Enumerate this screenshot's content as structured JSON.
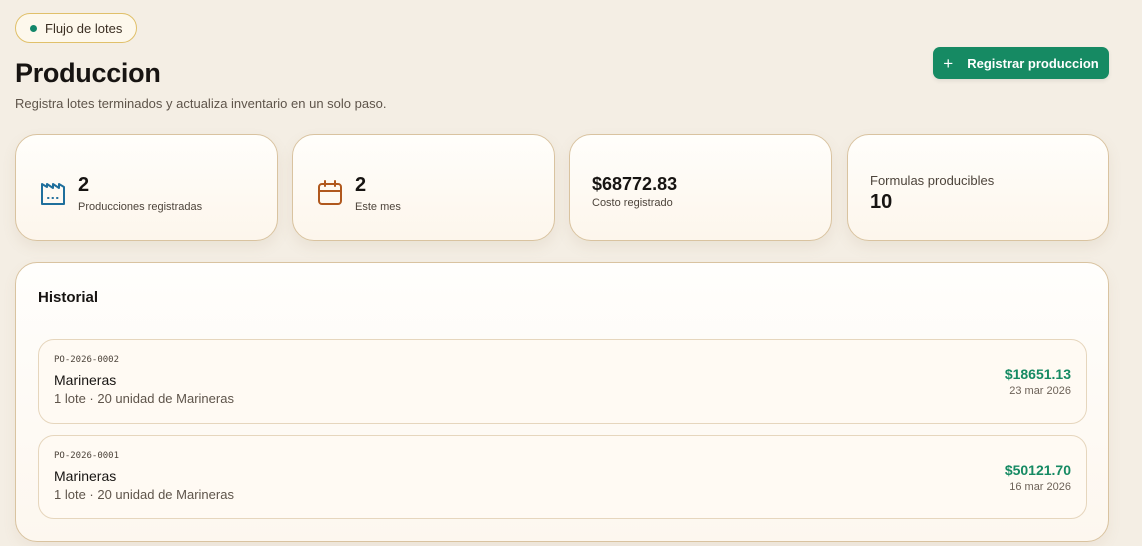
{
  "header": {
    "badge_label": "Flujo de lotes",
    "title": "Produccion",
    "subtitle": "Registra lotes terminados y actualiza inventario en un solo paso.",
    "primary_button_label": "Registrar produccion"
  },
  "stats": [
    {
      "icon": "factory-icon",
      "value": "2",
      "label": "Producciones registradas"
    },
    {
      "icon": "calendar-icon",
      "value": "2",
      "label": "Este mes"
    },
    {
      "icon": "",
      "value": "$68772.83",
      "label": "Costo registrado"
    },
    {
      "icon": "",
      "value": "10",
      "label": "Formulas producibles"
    }
  ],
  "history": {
    "title": "Historial",
    "items": [
      {
        "code": "PO-2026-0002",
        "name": "Marineras",
        "detail": "1 lote · 20 unidad de Marineras",
        "amount": "$18651.13",
        "date": "23 mar 2026"
      },
      {
        "code": "PO-2026-0001",
        "name": "Marineras",
        "detail": "1 lote · 20 unidad de Marineras",
        "amount": "$50121.70",
        "date": "16 mar 2026"
      }
    ]
  },
  "colors": {
    "background": "#f4eee4",
    "accent_green": "#168a63",
    "factory_icon": "#1f6f9c",
    "calendar_icon": "#b0581e",
    "card_border": "#d9c3a0",
    "badge_border": "#e0c06a"
  }
}
